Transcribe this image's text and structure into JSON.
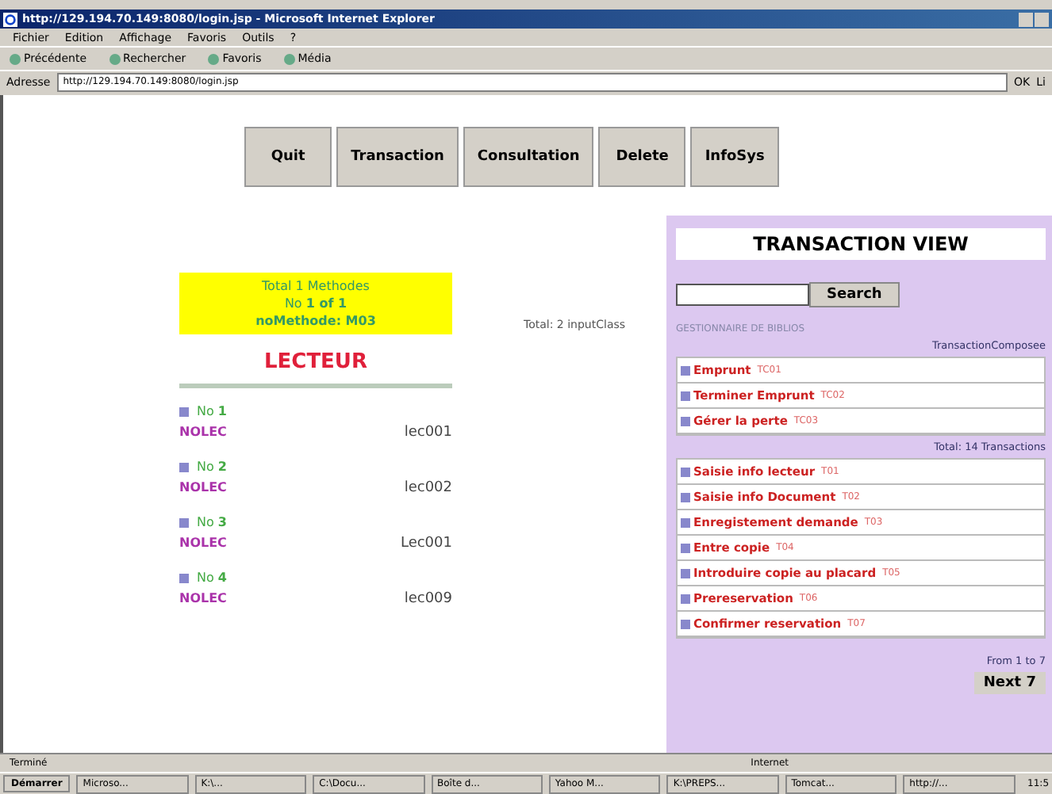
{
  "window": {
    "title": "http://129.194.70.149:8080/login.jsp - Microsoft Internet Explorer"
  },
  "menu": [
    "Fichier",
    "Edition",
    "Affichage",
    "Favoris",
    "Outils",
    "?"
  ],
  "toolbar": [
    "Précédente",
    "Rechercher",
    "Favoris",
    "Média"
  ],
  "address": {
    "label": "Adresse",
    "value": "http://129.194.70.149:8080/login.jsp",
    "go": "OK",
    "links": "Li"
  },
  "nav_buttons": [
    "Quit",
    "Transaction",
    "Consultation",
    "Delete",
    "InfoSys"
  ],
  "method_box": {
    "line1": "Total 1 Methodes",
    "line2": "No **1 of 1**",
    "line3": "noMethode: M03"
  },
  "section_title": "LECTEUR",
  "input_total": "Total: 2 inputClass",
  "readers": [
    {
      "no": "No",
      "num": "1",
      "label": "NOLEC",
      "value": "lec001"
    },
    {
      "no": "No",
      "num": "2",
      "label": "NOLEC",
      "value": "lec002"
    },
    {
      "no": "No",
      "num": "3",
      "label": "NOLEC",
      "value": "Lec001"
    },
    {
      "no": "No",
      "num": "4",
      "label": "NOLEC",
      "value": "lec009"
    }
  ],
  "panel": {
    "title": "TRANSACTION VIEW",
    "search_button": "Search",
    "subtitle": "GESTIONNAIRE DE BIBLIOS",
    "composed_label": "TransactionComposee",
    "composed": [
      {
        "name": "Emprunt",
        "code": "TC01"
      },
      {
        "name": "Terminer Emprunt",
        "code": "TC02"
      },
      {
        "name": "Gérer la perte",
        "code": "TC03"
      }
    ],
    "total": "Total: 14 Transactions",
    "transactions": [
      {
        "name": "Saisie info lecteur",
        "code": "T01"
      },
      {
        "name": "Saisie info Document",
        "code": "T02"
      },
      {
        "name": "Enregistement demande",
        "code": "T03"
      },
      {
        "name": "Entre copie",
        "code": "T04"
      },
      {
        "name": "Introduire copie au placard",
        "code": "T05"
      },
      {
        "name": "Prereservation",
        "code": "T06"
      },
      {
        "name": "Confirmer reservation",
        "code": "T07"
      }
    ],
    "range": "From 1 to 7",
    "next": "Next 7"
  },
  "status_bar": {
    "text": "Terminé",
    "zone": "Internet"
  },
  "taskbar": {
    "start": "Démarrer",
    "items": [
      "Microso...",
      "K:\\...",
      "C:\\Docu...",
      "Boîte d...",
      "Yahoo M...",
      "K:\\PREPS...",
      "Tomcat...",
      "http://..."
    ],
    "clock": "11:5"
  }
}
